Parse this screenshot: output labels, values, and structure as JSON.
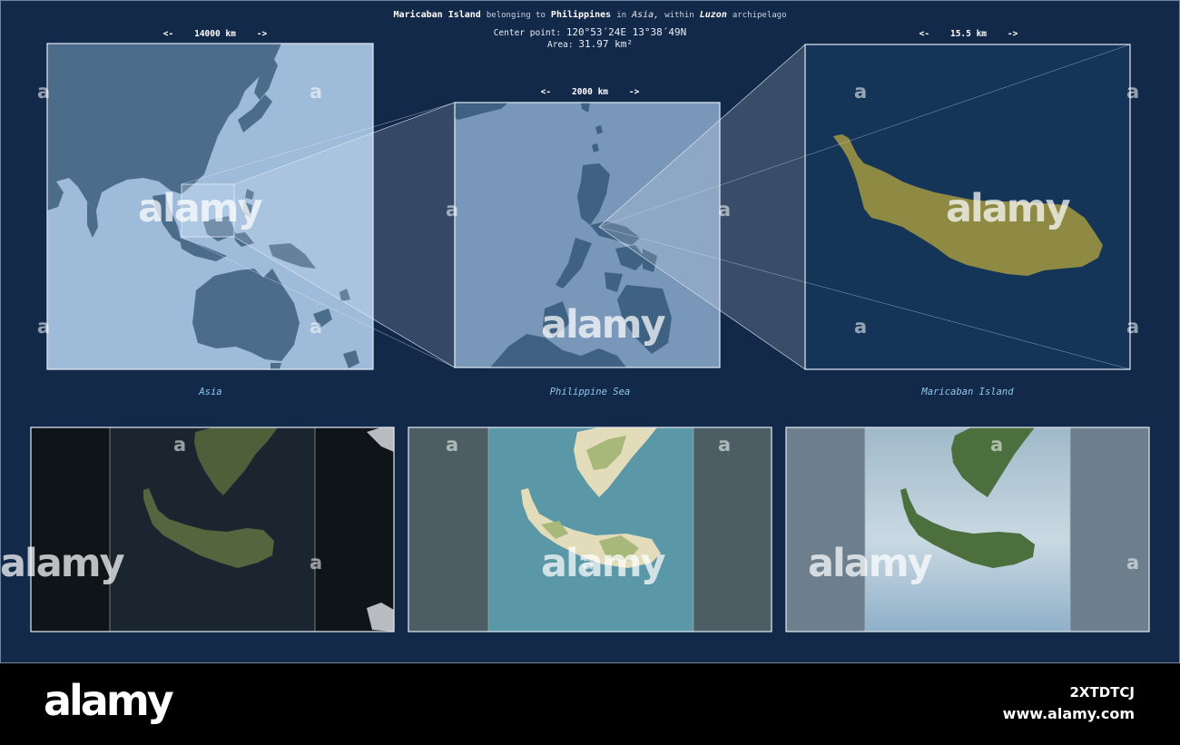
{
  "header": {
    "place": "Maricaban Island",
    "belonging": "belonging to",
    "country": "Philippines",
    "in_word": "in",
    "continent": "Asia,",
    "within": "within",
    "archipelago_name": "Luzon",
    "archipelago_word": "archipelago",
    "center_label": "Center point:",
    "center_value": "120°53´24E  13°38´49N",
    "area_label": "Area:",
    "area_value": "31.97 km²"
  },
  "panels": [
    {
      "caption": "Asia",
      "scale": "<-    14000 km    ->"
    },
    {
      "caption": "Philippine Sea",
      "scale": "<-    2000 km    ->"
    },
    {
      "caption": "Maricaban Island",
      "scale": "<-    15.5 km    ->"
    }
  ],
  "watermark": {
    "text": "alamy",
    "small": "a"
  },
  "footer": {
    "logo": "alamy",
    "stock_id": "2XTDTCJ",
    "site": "www.alamy.com"
  },
  "colors": {
    "background": "#13294a",
    "ocean_light": "#8fb0d4",
    "land_dark": "#2f5478",
    "island_fill": "#8e8a43",
    "caption": "#8fc7ec"
  }
}
